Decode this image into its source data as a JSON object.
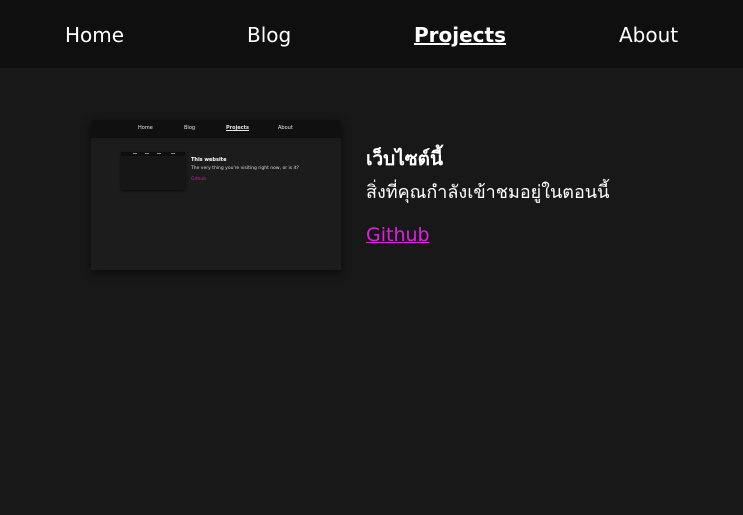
{
  "nav": {
    "home": "Home",
    "blog": "Blog",
    "projects": "Projects",
    "about": "About",
    "active": "projects"
  },
  "project": {
    "title": "เว็บไซต์นี้",
    "description": "สิ่งที่คุณกำลังเข้าชมอยู่ในตอนนี้",
    "link_label": "Github",
    "thumbnail": {
      "nav": {
        "home": "Home",
        "blog": "Blog",
        "projects": "Projects",
        "about": "About"
      },
      "title": "This website",
      "description": "The very thing you're visiting right now, or is it?",
      "link_label": "Github"
    }
  },
  "colors": {
    "background": "#181818",
    "navbar": "#0f0f0f",
    "text": "#ffffff",
    "link": "#e01ee0"
  }
}
